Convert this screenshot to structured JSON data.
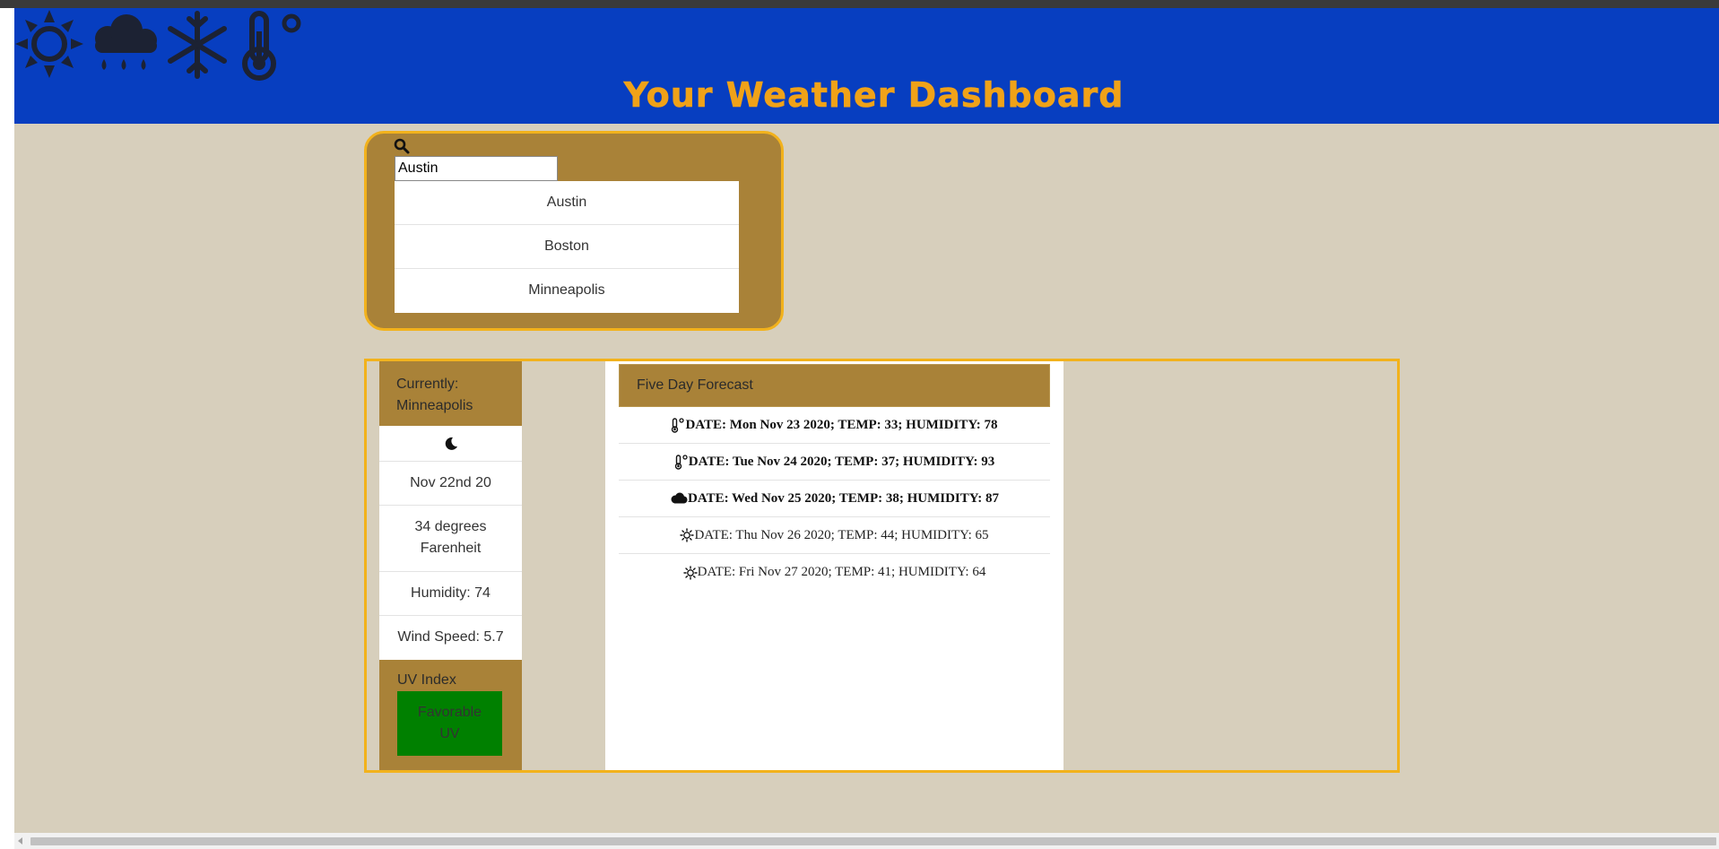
{
  "header": {
    "title": "Your Weather Dashboard",
    "icons": [
      "sun-icon",
      "rain-cloud-icon",
      "snowflake-icon",
      "thermometer-degree-icon"
    ]
  },
  "search": {
    "icon": "search-icon",
    "input_value": "Austin",
    "cities": [
      "Austin",
      "Boston",
      "Minneapolis"
    ]
  },
  "current": {
    "header_label": "Currently:",
    "city": "Minneapolis",
    "icon": "moon-icon",
    "date": "Nov 22nd 20",
    "temp_line1": "34 degrees",
    "temp_line2": "Farenheit",
    "humidity": "Humidity: 74",
    "wind": "Wind Speed: 5.7"
  },
  "uv": {
    "label": "UV Index",
    "badge_line1": "Favorable",
    "badge_line2": "UV",
    "badge_color": "#008000"
  },
  "forecast": {
    "title": "Five Day Forecast",
    "items": [
      {
        "icon": "thermometer-degree-icon",
        "text": "DATE: Mon Nov 23 2020; TEMP: 33; HUMIDITY: 78"
      },
      {
        "icon": "thermometer-degree-icon",
        "text": "DATE: Tue Nov 24 2020; TEMP: 37; HUMIDITY: 93"
      },
      {
        "icon": "cloud-icon",
        "text": "DATE: Wed Nov 25 2020; TEMP: 38; HUMIDITY: 87"
      },
      {
        "icon": "sun-outline-icon",
        "text": "DATE: Thu Nov 26 2020; TEMP: 44; HUMIDITY: 65"
      },
      {
        "icon": "sun-outline-icon",
        "text": "DATE: Fri Nov 27 2020; TEMP: 41; HUMIDITY: 64"
      }
    ]
  },
  "colors": {
    "header_bg": "#073ec0",
    "title": "#f0a218",
    "page_bg": "#d7cfbc",
    "panel": "#a98238",
    "border_accent": "#f2b21c"
  }
}
